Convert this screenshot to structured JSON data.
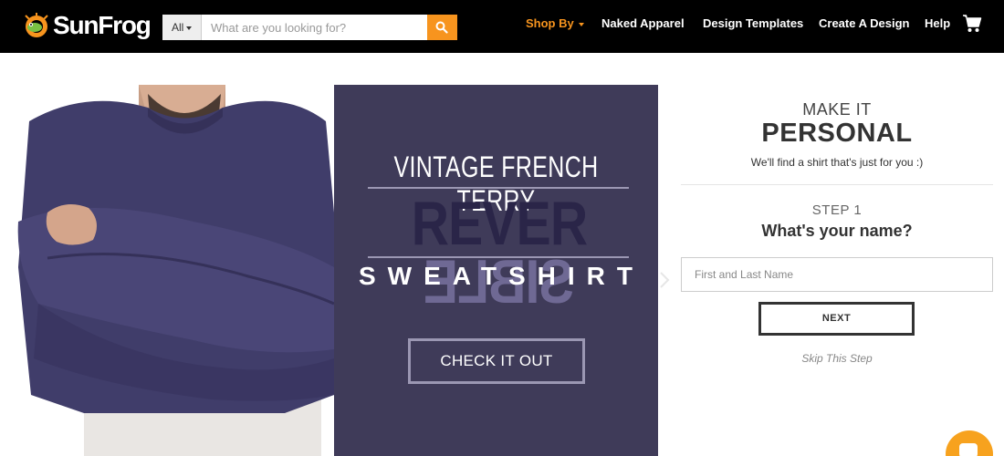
{
  "header": {
    "logo_text": "SunFrog",
    "search": {
      "category": "All",
      "placeholder": "What are you looking for?"
    },
    "nav": [
      {
        "label": "Shop By"
      },
      {
        "label": "Naked Apparel"
      },
      {
        "label": "Design Templates"
      },
      {
        "label": "Create A Design"
      },
      {
        "label": "Help"
      }
    ]
  },
  "hero": {
    "promo_line1": "VINTAGE FRENCH TERRY",
    "promo_word_normal": "REVER",
    "promo_word_mirrored": "SIBLE",
    "promo_line3": "SWEATSHIRT",
    "cta_label": "CHECK IT OUT"
  },
  "personal": {
    "kicker": "MAKE IT",
    "title": "PERSONAL",
    "subtitle": "We'll find a shirt that's just for you :)",
    "step_label": "STEP 1",
    "question": "What's your name?",
    "name_placeholder": "First and Last Name",
    "next_label": "NEXT",
    "skip_label": "Skip This Step"
  },
  "colors": {
    "accent": "#f7941e",
    "promo_bg": "#3f3b59",
    "navbar_bg": "#000000"
  },
  "icons": [
    "frog-logo-icon",
    "search-icon",
    "cart-icon",
    "chevron-left-icon",
    "chevron-right-icon",
    "chat-icon"
  ]
}
